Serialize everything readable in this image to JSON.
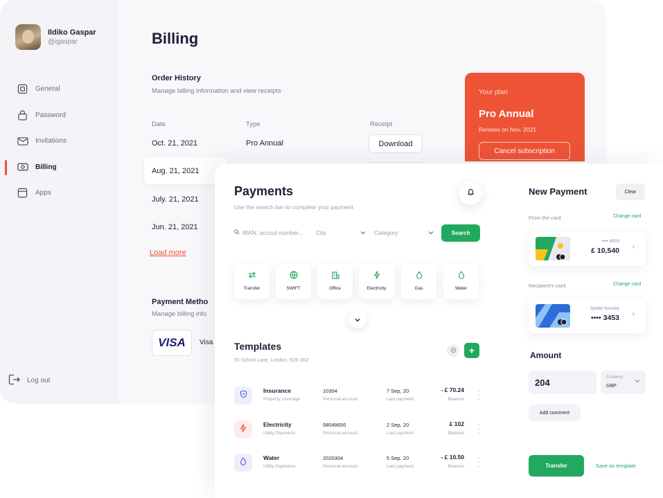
{
  "profile": {
    "name": "Ildiko Gaspar",
    "handle": "@igaspar"
  },
  "sidebar": {
    "items": [
      {
        "label": "General",
        "icon": "general-icon"
      },
      {
        "label": "Password",
        "icon": "lock-icon"
      },
      {
        "label": "Invitations",
        "icon": "mail-icon"
      },
      {
        "label": "Billing",
        "icon": "billing-icon",
        "active": true
      },
      {
        "label": "Apps",
        "icon": "apps-icon"
      }
    ],
    "logout": "Log out"
  },
  "billing": {
    "title": "Billing",
    "order_history": {
      "title": "Order History",
      "subtitle": "Manage billing information and view receipts",
      "columns": [
        "Date",
        "Type",
        "Receipt"
      ],
      "rows": [
        {
          "date": "Oct. 21, 2021",
          "type": "Pro Annual",
          "receipt": "Download"
        },
        {
          "date": "Aug. 21, 2021"
        },
        {
          "date": "July. 21, 2021"
        },
        {
          "date": "Jun. 21, 2021"
        }
      ],
      "load_more": "Load more"
    },
    "payment_method": {
      "title": "Payment Metho",
      "subtitle": "Manage billing info",
      "card_brand": "VISA",
      "card_label": "Visa"
    },
    "plan": {
      "label": "Your plan",
      "name": "Pro Annual",
      "renews": "Renews on Nov. 2021",
      "cancel": "Cancel subscription"
    }
  },
  "payments": {
    "title": "Payments",
    "subtitle": "Use the search bar to complete your payment",
    "search_placeholder": "IBAN, accout number...",
    "city_placeholder": "City",
    "category_placeholder": "Category",
    "search_button": "Search",
    "categories": [
      {
        "label": "Transfer",
        "icon": "transfer-icon"
      },
      {
        "label": "SWIFT",
        "icon": "globe-icon"
      },
      {
        "label": "Office",
        "icon": "office-icon"
      },
      {
        "label": "Electricity",
        "icon": "lightning-icon"
      },
      {
        "label": "Gas",
        "icon": "flame-icon"
      },
      {
        "label": "Water",
        "icon": "drop-icon"
      }
    ],
    "templates": {
      "title": "Templates",
      "address": "55 School Lane, London, N29 3RZ",
      "rows": [
        {
          "name": "Insurance",
          "category": "Property coverage",
          "account": "10304",
          "account_label": "Personal account",
          "date": "7 Sep, 20",
          "date_label": "Last payment",
          "amount": "- £ 70.24",
          "balance_label": "Balance",
          "icon": "shield-icon",
          "color": "#3f63d9"
        },
        {
          "name": "Electricity",
          "category": "Utility Payments",
          "account": "58049650",
          "account_label": "Personal account",
          "date": "2 Sep, 20",
          "date_label": "Last payment",
          "amount": "£ 102",
          "balance_label": "Balance",
          "icon": "lightning-icon",
          "color": "#ef5236"
        },
        {
          "name": "Water",
          "category": "Utility Payments",
          "account": "2020304",
          "account_label": "Personal account",
          "date": "5 Sep, 20",
          "date_label": "Last payment",
          "amount": "- £ 10.50",
          "balance_label": "Balance",
          "icon": "drop-icon",
          "color": "#6a4fd6"
        }
      ]
    }
  },
  "new_payment": {
    "title": "New Payment",
    "clear": "Clear",
    "from_label": "From the card",
    "change_card": "Change card",
    "from_card": {
      "number": "•••• 4903",
      "amount": "£ 10,540"
    },
    "recipient_label": "Recipient's card",
    "recipient_card": {
      "name": "Spider foundry",
      "number": "•••• 3453"
    },
    "amount_title": "Amount",
    "amount_value": "204",
    "currency_label": "Currency",
    "currency_value": "GBP",
    "add_comment": "Add comment",
    "transfer": "Transfer",
    "save_template": "Save as template"
  },
  "colors": {
    "accent_red": "#ee5336",
    "accent_green": "#22a95e",
    "text_dark": "#1d1d35"
  }
}
